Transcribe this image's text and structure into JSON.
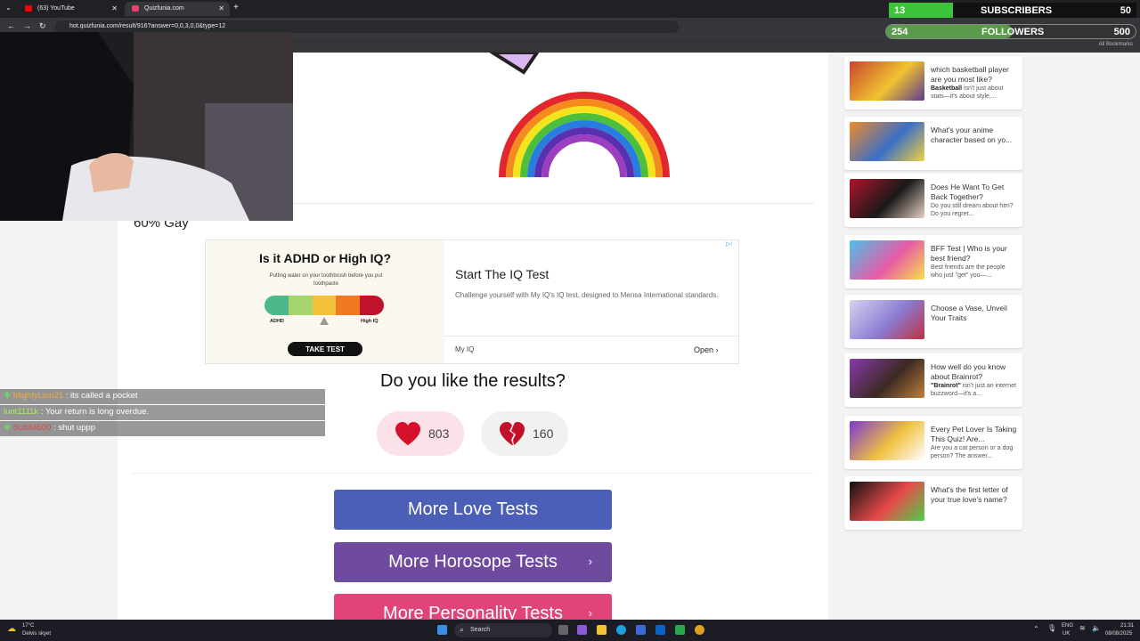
{
  "browser": {
    "tabs": [
      {
        "label": "(63) YouTube"
      },
      {
        "label": "Quizfunia.com"
      }
    ],
    "url": "hot.quizfunia.com/result/916?answer=0,0,3,0,0&type=12",
    "all_bookmarks": "All Bookmarks"
  },
  "overlay": {
    "subscribers": {
      "label": "SUBSCRIBERS",
      "current": "13",
      "goal": "50",
      "progress": 0.26
    },
    "followers": {
      "label": "FOLLOWERS",
      "current": "254",
      "goal": "500",
      "progress": 0.508
    },
    "chat": [
      {
        "user": "MightyLion21",
        "message": " : its called a pocket",
        "badge": true,
        "color": "n1"
      },
      {
        "user": "lunt1111k",
        "message": " : Your return is long overdue.",
        "badge": false,
        "color": "n2"
      },
      {
        "user": "Sufol4500",
        "message": " : shut uppp",
        "badge": true,
        "color": "n3"
      }
    ]
  },
  "result": {
    "text": "60% Gay"
  },
  "ad": {
    "question": "Is it ADHD or High IQ?",
    "subtitle": "Putting water on your toothbrush before you put toothpaste",
    "scale_left": "ADHD",
    "scale_right": "High IQ",
    "scale_colors": [
      "#4db88a",
      "#a5d56e",
      "#f3c23b",
      "#f07a24",
      "#c0122b"
    ],
    "take_test": "TAKE TEST",
    "title": "Start The IQ Test",
    "description": "Challenge yourself with My IQ's IQ test, designed to Mensa International standards.",
    "brand": "My IQ",
    "open": "Open"
  },
  "feedback": {
    "question": "Do you like the results?",
    "likes": "803",
    "dislikes": "160"
  },
  "buttons": [
    {
      "label": "More Love Tests",
      "arrow": ""
    },
    {
      "label": "More Horosope Tests",
      "arrow": "›"
    },
    {
      "label": "More Personality Tests",
      "arrow": "›"
    }
  ],
  "sidebar": [
    {
      "title": "which basketball player are you most like?",
      "desc_bold": "Basketball",
      "desc": " isn't just about stats—it's about style,...",
      "thumb": [
        "#c8452f",
        "#f2c230",
        "#5a3a8f"
      ]
    },
    {
      "title": "What's your anime character based on yo...",
      "desc_bold": "",
      "desc": "",
      "thumb": [
        "#f08a2a",
        "#3a6fc8",
        "#f2d23a"
      ]
    },
    {
      "title": "Does He Want To Get Back Together?",
      "desc_bold": "",
      "desc": "Do you still dream about him? Do you regret...",
      "thumb": [
        "#b0142a",
        "#1a1a1a",
        "#e8d0c0"
      ]
    },
    {
      "title": "BFF Test | Who is your best friend?",
      "desc_bold": "",
      "desc": "Best friends are the people who just \"get\" you—...",
      "thumb": [
        "#4ac3e8",
        "#e85aa8",
        "#f5e04a"
      ]
    },
    {
      "title": "Choose a Vase, Unveil Your Traits",
      "desc_bold": "",
      "desc": "",
      "thumb": [
        "#d8d2f0",
        "#8a7ad0",
        "#c03040"
      ]
    },
    {
      "title": "How well do you know about Brainrot?",
      "desc_bold": "\"Brainrot\"",
      "desc": " isn't just an internet buzzword—it's a...",
      "thumb": [
        "#8a3ab0",
        "#3a2a20",
        "#c08040"
      ]
    },
    {
      "title": "Every Pet Lover Is Taking This Quiz! Are...",
      "desc_bold": "",
      "desc": "Are you a cat person or a dog person? The answer...",
      "thumb": [
        "#7a3ad0",
        "#f0c040",
        "#ffffff"
      ]
    },
    {
      "title": "What's the first letter of your true love's name?",
      "desc_bold": "",
      "desc": "",
      "thumb": [
        "#111111",
        "#e84a4a",
        "#4ad04a"
      ]
    }
  ],
  "taskbar": {
    "weather_temp": "17°C",
    "weather_desc": "Delvis skyet",
    "search": "Search",
    "lang": "ENG",
    "region": "UK",
    "time": "21:31",
    "date": "08/08/2025"
  }
}
